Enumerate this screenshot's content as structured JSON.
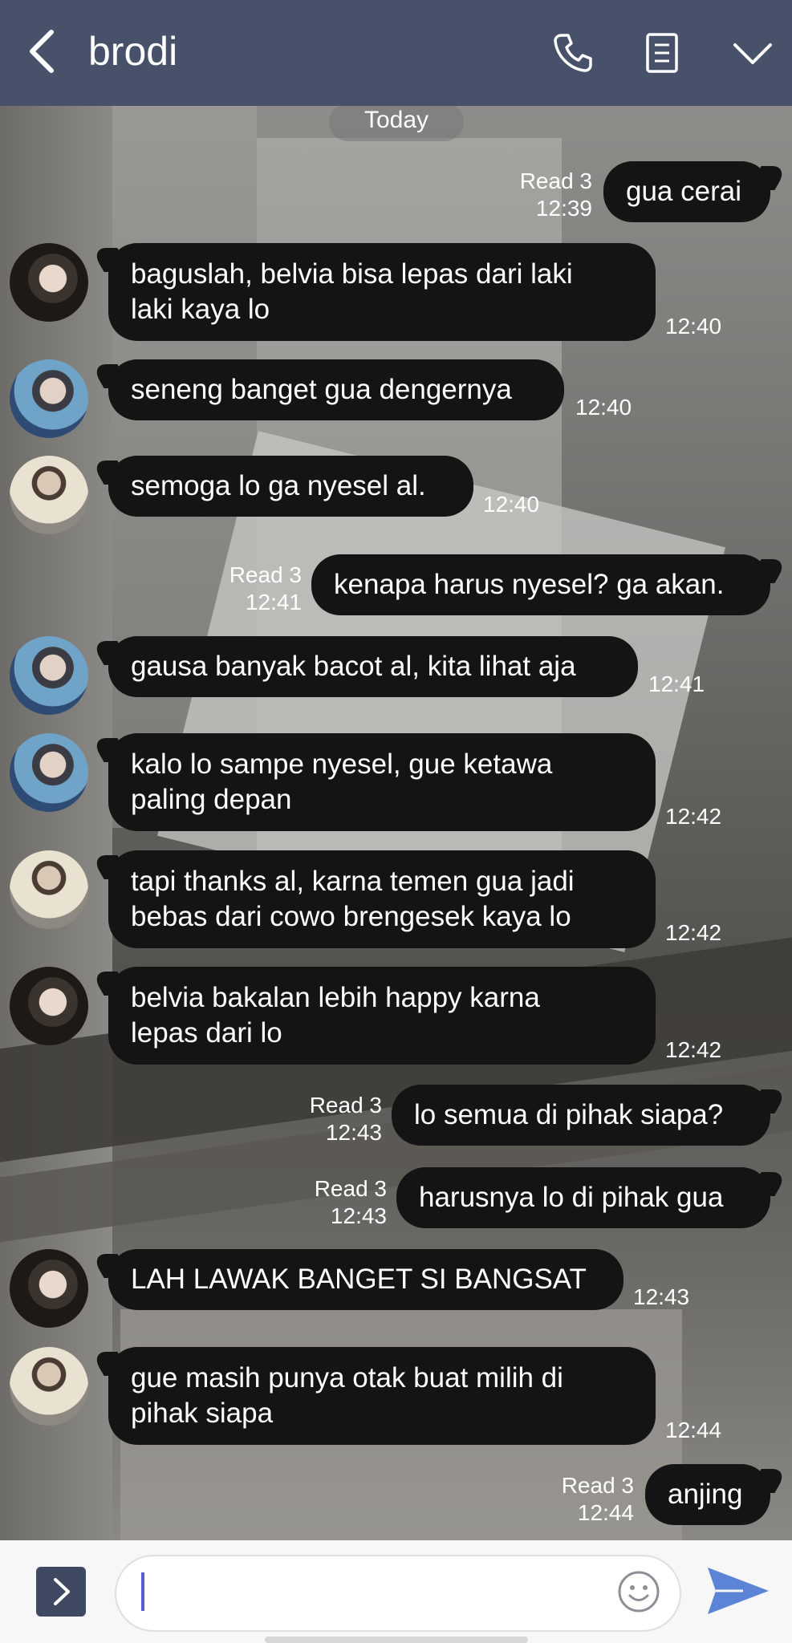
{
  "header": {
    "title": "brodi"
  },
  "date_label": "Today",
  "messages": {
    "m1": {
      "text": "gua cerai",
      "read": "Read 3",
      "time": "12:39"
    },
    "m2": {
      "line1": "baguslah, belvia bisa lepas dari laki",
      "line2": "laki kaya lo",
      "time": "12:40"
    },
    "m3": {
      "text": "seneng banget gua dengernya",
      "time": "12:40"
    },
    "m4": {
      "text": "semoga lo ga nyesel al.",
      "time": "12:40"
    },
    "m5": {
      "text": "kenapa harus nyesel? ga akan.",
      "read": "Read 3",
      "time": "12:41"
    },
    "m6": {
      "text": "gausa banyak bacot al, kita lihat aja",
      "time": "12:41"
    },
    "m7": {
      "line1": "kalo lo sampe nyesel, gue ketawa",
      "line2": "paling depan",
      "time": "12:42"
    },
    "m8": {
      "line1": "tapi thanks al, karna temen gua jadi",
      "line2": "bebas dari cowo brengesek kaya lo",
      "time": "12:42"
    },
    "m9": {
      "line1": "belvia bakalan lebih happy karna",
      "line2": "lepas dari lo",
      "time": "12:42"
    },
    "m10": {
      "text": "lo semua di pihak siapa?",
      "read": "Read 3",
      "time": "12:43"
    },
    "m11": {
      "text": "harusnya lo di pihak gua",
      "read": "Read 3",
      "time": "12:43"
    },
    "m12": {
      "text": "LAH LAWAK BANGET SI BANGSAT",
      "time": "12:43"
    },
    "m13": {
      "line1": "gue masih punya otak buat milih di",
      "line2": "pihak siapa",
      "time": "12:44"
    },
    "m14": {
      "text": "anjing",
      "read": "Read 3",
      "time": "12:44"
    }
  },
  "icons": {
    "back": "chevron-left-icon",
    "call": "phone-icon",
    "notes": "document-icon",
    "menu": "chevron-down-icon",
    "plus": "chevron-right-icon",
    "emoji": "smiley-icon",
    "send": "send-icon"
  },
  "colors": {
    "header": "#47526a",
    "bubble": "#141414",
    "send": "#5b83d6",
    "input_bar": "#f7f7f8"
  }
}
